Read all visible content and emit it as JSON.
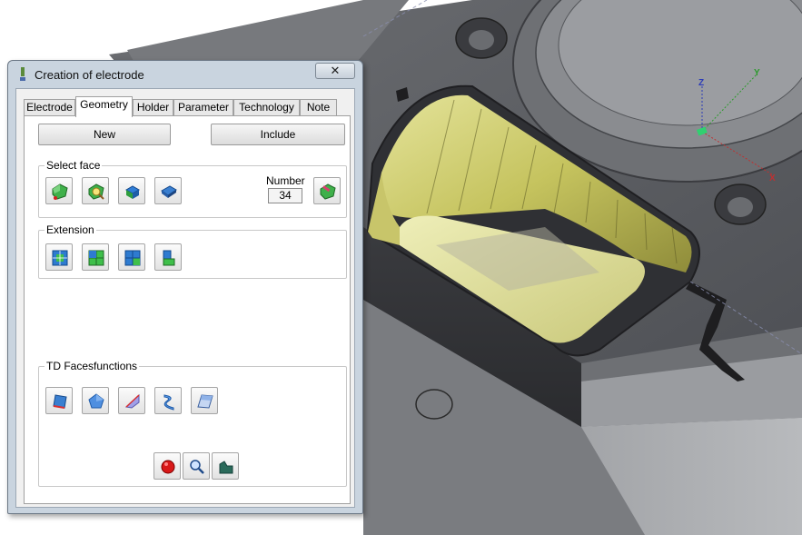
{
  "window": {
    "title": "Creation of electrode",
    "close_glyph": "✕"
  },
  "tabs": [
    {
      "label": "Electrode",
      "active": false
    },
    {
      "label": "Geometry",
      "active": true
    },
    {
      "label": "Holder",
      "active": false
    },
    {
      "label": "Parameter",
      "active": false
    },
    {
      "label": "Technology",
      "active": false
    },
    {
      "label": "Note",
      "active": false
    }
  ],
  "buttons": {
    "new_label": "New",
    "include_label": "Include"
  },
  "select_face": {
    "label": "Select face",
    "number_label": "Number",
    "number_value": "34",
    "icons": [
      "select-face-icon",
      "select-face-zoom-icon",
      "select-face-blue-icon",
      "select-face-block-icon",
      "select-face-remove-icon"
    ]
  },
  "extension": {
    "label": "Extension",
    "icons": [
      "extend-grid-icon",
      "extend-green-grid-icon",
      "extend-corner-icon",
      "extend-step-icon"
    ]
  },
  "td_faces": {
    "label": "TD Facesfunctions",
    "icons": [
      "face-parallelogram-icon",
      "face-pentagon-icon",
      "face-fan-icon",
      "face-twist-icon",
      "face-flat-icon"
    ]
  },
  "bottom_icons": [
    "record-icon",
    "zoom-icon",
    "shape-icon"
  ],
  "axes": {
    "z_label": "Z",
    "y_label": "Y",
    "x_label": "X"
  },
  "colors": {
    "model_gray": "#5c5e63",
    "highlight_yellow": "#d8d67a",
    "dialog_frame": "#c9d4df"
  }
}
